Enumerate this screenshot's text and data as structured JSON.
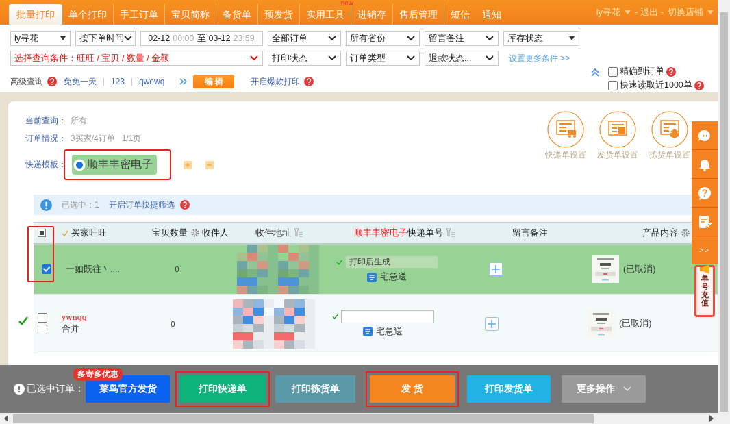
{
  "nav": {
    "tabs": [
      {
        "label": "批量打印",
        "selected": true
      },
      {
        "label": "单个打印",
        "selected": false
      },
      {
        "label": "手工订单",
        "selected": false
      },
      {
        "label": "宝贝简称",
        "selected": false
      },
      {
        "label": "备货单",
        "selected": false
      },
      {
        "label": "预发货",
        "selected": false
      },
      {
        "label": "实用工具",
        "selected": false,
        "badge": "new"
      },
      {
        "label": "进销存",
        "selected": false
      },
      {
        "label": "售后管理",
        "selected": false
      },
      {
        "label": "短信",
        "selected": false
      },
      {
        "label": "通知",
        "selected": false
      }
    ],
    "user": "ly寻花",
    "logout": "- 退出 -",
    "switch_shop": "切换店铺"
  },
  "filters": {
    "row1": [
      {
        "kind": "combo",
        "value": "ly寻花"
      },
      {
        "kind": "select",
        "value": "按下单时间"
      },
      {
        "kind": "daterange",
        "from_date": "02-12",
        "from_time": "00:00",
        "separator": "至",
        "to_date": "03-12",
        "to_time": "23:59"
      },
      {
        "kind": "select",
        "value": "全部订单"
      },
      {
        "kind": "select",
        "value": "所有省份"
      },
      {
        "kind": "select",
        "value": "留言备注"
      },
      {
        "kind": "combo",
        "value": "库存状态"
      }
    ],
    "row2": [
      {
        "kind": "condition",
        "value": "选择查询条件：旺旺 / 宝贝 / 数量 / 金额"
      },
      {
        "kind": "select",
        "value": "打印状态"
      },
      {
        "kind": "select",
        "value": "订单类型"
      },
      {
        "kind": "select",
        "value": "退款状态..."
      },
      {
        "kind": "link",
        "value": "设置更多条件 >>"
      }
    ],
    "checkboxes": [
      {
        "label": "精确到订单",
        "checked": false
      },
      {
        "label": "快速读取近1000单",
        "checked": false
      }
    ],
    "advanced": {
      "label": "高级查询",
      "presets": [
        "免免一天",
        "123",
        "qwewq"
      ],
      "edit_button": "编 辑",
      "hot_print": "开启爆款打印"
    }
  },
  "summary": {
    "query_label": "当前查询：",
    "query_value": "所有",
    "orders_label": "订单情况：",
    "orders_value": "3买家/4订单   1/1页",
    "template_label": "快递模板：",
    "templates": [
      {
        "label": "顺丰丰密电子",
        "selected": true
      }
    ],
    "template_highlighted": true
  },
  "settings": [
    {
      "kind": "express",
      "label": "快递单设置"
    },
    {
      "kind": "delivery",
      "label": "发货单设置"
    },
    {
      "kind": "picking",
      "label": "拣货单设置"
    }
  ],
  "info_bar": {
    "selected_text": "已选中：1",
    "link": "开启订单快捷筛选"
  },
  "table": {
    "checkbox_column_highlighted": true,
    "header_checked": true,
    "columns": [
      {
        "kind": "buyer",
        "label": "买家旺旺"
      },
      {
        "kind": "quantity",
        "label": "宝贝数量"
      },
      {
        "kind": "recipient",
        "label": "收件人"
      },
      {
        "kind": "address",
        "label": "收件地址"
      },
      {
        "kind": "tracking",
        "template": "顺丰丰密电子",
        "label": "快递单号"
      },
      {
        "kind": "remark",
        "label": "留言备注"
      },
      {
        "kind": "product",
        "label": "产品内容"
      }
    ],
    "rows": [
      {
        "selected": true,
        "checked": true,
        "printed": false,
        "buyer": "一如既往丶....",
        "quantity": "0",
        "tracking": "打印后生成",
        "tracking_disabled": true,
        "service": "宅急送",
        "product_status": "(已取消)"
      },
      {
        "selected": false,
        "checked": false,
        "printed": true,
        "buyer": "ywnqq",
        "merge": {
          "label": "合并",
          "checked": false
        },
        "quantity": "0",
        "tracking_disabled": false,
        "service": "宅急送",
        "product_status": "(已取消)"
      }
    ]
  },
  "side_panel": {
    "more": ">>",
    "recharge": "单号充值"
  },
  "action_bar": {
    "selected_label": "已选中订单：",
    "buttons": [
      {
        "kind": "blue",
        "label": "菜鸟官方发货",
        "badge": "多寄多优惠"
      },
      {
        "kind": "green",
        "label": "打印快递单",
        "highlighted": true
      },
      {
        "kind": "teal",
        "label": "打印拣货单"
      },
      {
        "kind": "orange",
        "label": "发 货",
        "highlighted": true
      },
      {
        "kind": "sky",
        "label": "打印发货单"
      },
      {
        "kind": "more",
        "label": "更多操作"
      }
    ]
  }
}
